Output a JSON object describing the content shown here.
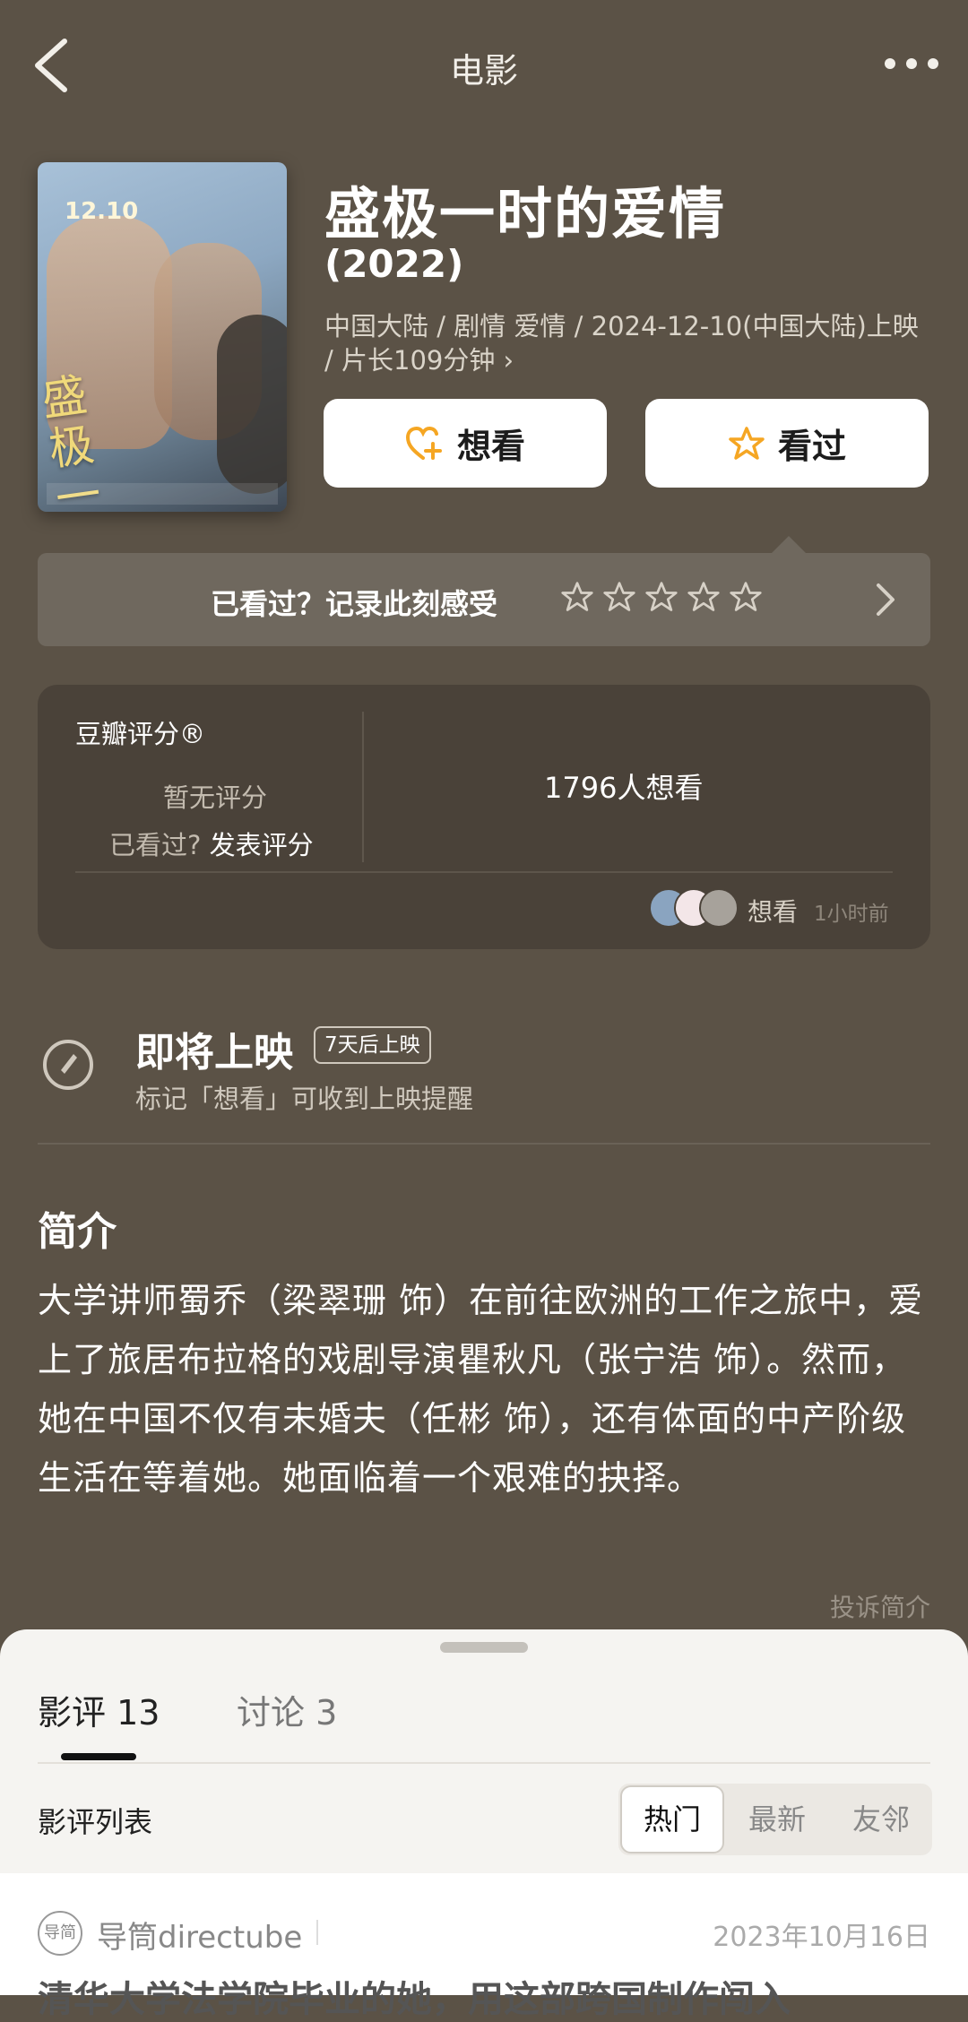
{
  "header": {
    "title": "电影",
    "back_icon": "chevron-left-icon",
    "more_icon": "more-dots-icon"
  },
  "movie": {
    "title": "盛极一时的爱情",
    "year": "(2022)",
    "meta": "中国大陆 / 剧情 爱情 / 2024-12-10(中国大陆)上映 / 片长109分钟 ›",
    "poster_title": "盛极一时的爱情",
    "poster_date": "12.10"
  },
  "actions": {
    "want_label": "想看",
    "seen_label": "看过"
  },
  "record": {
    "text": "已看过？记录此刻感受",
    "stars": 5
  },
  "rating": {
    "label": "豆瓣评分®",
    "none": "暂无评分",
    "seen_prefix": "已看过?",
    "seen_link": "发表评分",
    "want_count": "1796人想看",
    "activity_label": "想看",
    "activity_time": "1小时前"
  },
  "coming": {
    "title": "即将上映",
    "badge": "7天后上映",
    "subtitle": "标记「想看」可收到上映提醒"
  },
  "intro": {
    "heading": "简介",
    "text": "大学讲师蜀乔（梁翠珊 饰）在前往欧洲的工作之旅中，爱上了旅居布拉格的戏剧导演瞿秋凡（张宁浩 饰）。然而，她在中国不仅有未婚夫（任彬 饰），还有体面的中产阶级生活在等着她。她面临着一个艰难的抉择。",
    "complain": "投诉简介"
  },
  "sheet": {
    "tabs": [
      {
        "label": "影评 13"
      },
      {
        "label": "讨论 3"
      }
    ],
    "list_heading": "影评列表",
    "sort": [
      "热门",
      "最新",
      "友邻"
    ],
    "review": {
      "logo_text": "导简",
      "author": "导筒directube",
      "date": "2023年10月16日",
      "title": "清华大学法学院毕业的她，用这部跨国制作闯入"
    }
  },
  "colors": {
    "accent_star": "#f5a623",
    "background": "#5b5246"
  }
}
